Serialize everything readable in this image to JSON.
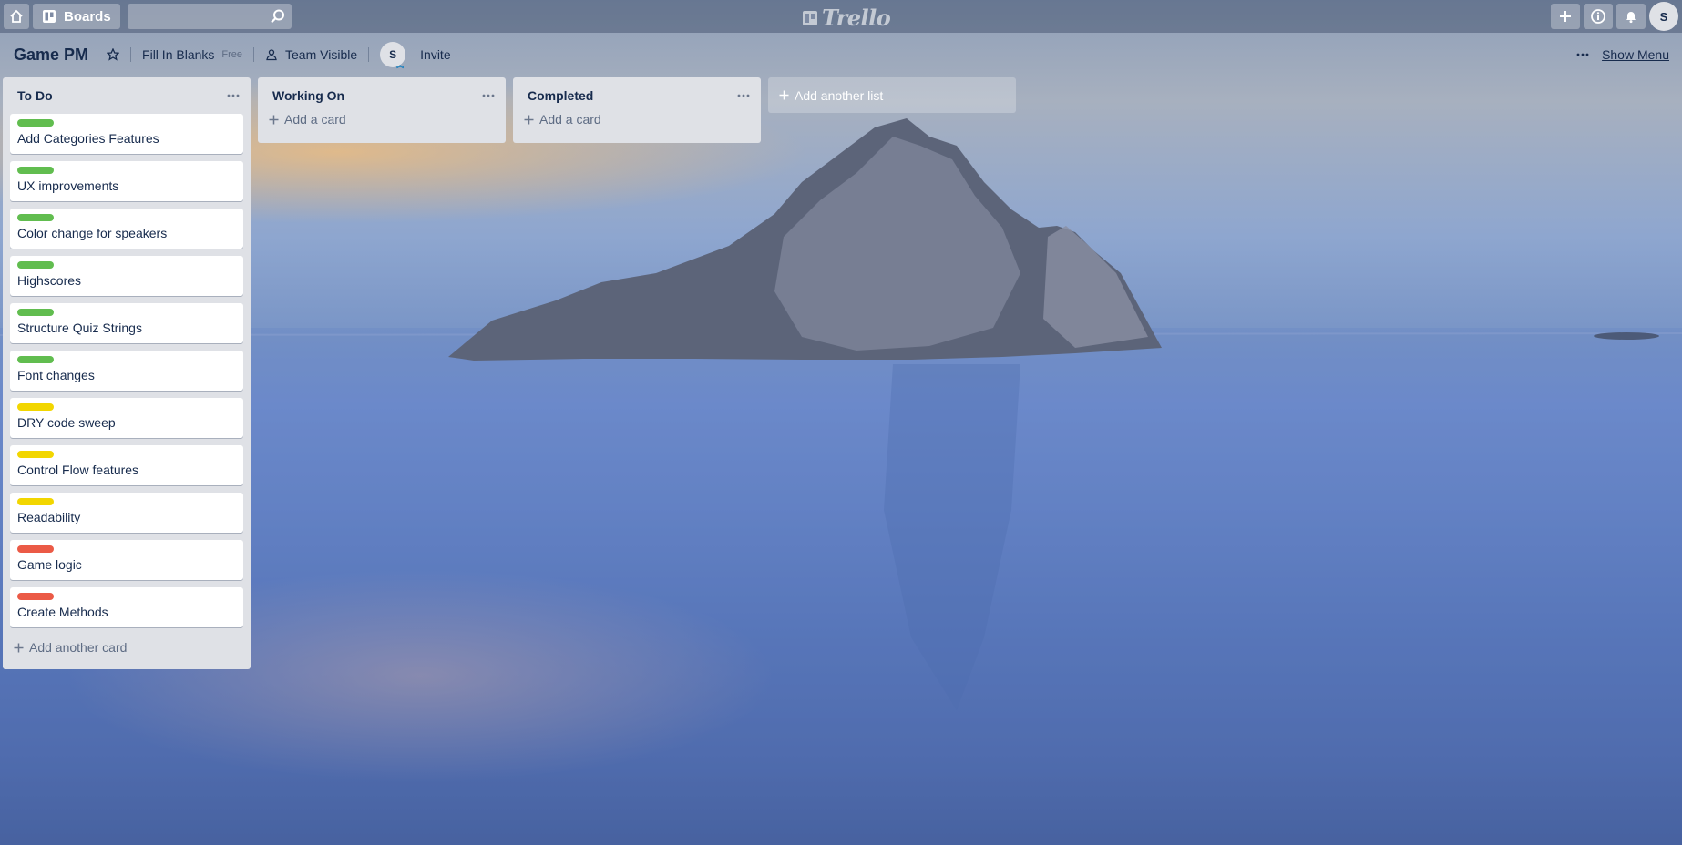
{
  "header": {
    "home_icon": "home-icon",
    "boards_label": "Boards",
    "search_placeholder": "",
    "logo_text": "Trello",
    "user_initial": "S"
  },
  "board": {
    "title": "Game PM",
    "team_name": "Fill In Blanks",
    "plan_badge": "Free",
    "visibility": "Team Visible",
    "member_initial": "S",
    "invite_label": "Invite",
    "show_menu_label": "Show Menu"
  },
  "colors": {
    "green": "#61bd4f",
    "yellow": "#f2d600",
    "red": "#eb5a46"
  },
  "lists": [
    {
      "title": "To Do",
      "add_card_label": "Add another card",
      "cards": [
        {
          "title": "Add Categories Features",
          "label": "green"
        },
        {
          "title": "UX improvements",
          "label": "green"
        },
        {
          "title": "Color change for speakers",
          "label": "green"
        },
        {
          "title": "Highscores",
          "label": "green"
        },
        {
          "title": "Structure Quiz Strings",
          "label": "green"
        },
        {
          "title": "Font changes",
          "label": "green"
        },
        {
          "title": "DRY code sweep",
          "label": "yellow"
        },
        {
          "title": "Control Flow features",
          "label": "yellow"
        },
        {
          "title": "Readability",
          "label": "yellow"
        },
        {
          "title": "Game logic",
          "label": "red"
        },
        {
          "title": "Create Methods",
          "label": "red"
        }
      ]
    },
    {
      "title": "Working On",
      "add_card_label": "Add a card",
      "cards": []
    },
    {
      "title": "Completed",
      "add_card_label": "Add a card",
      "cards": []
    }
  ],
  "add_list_label": "Add another list"
}
